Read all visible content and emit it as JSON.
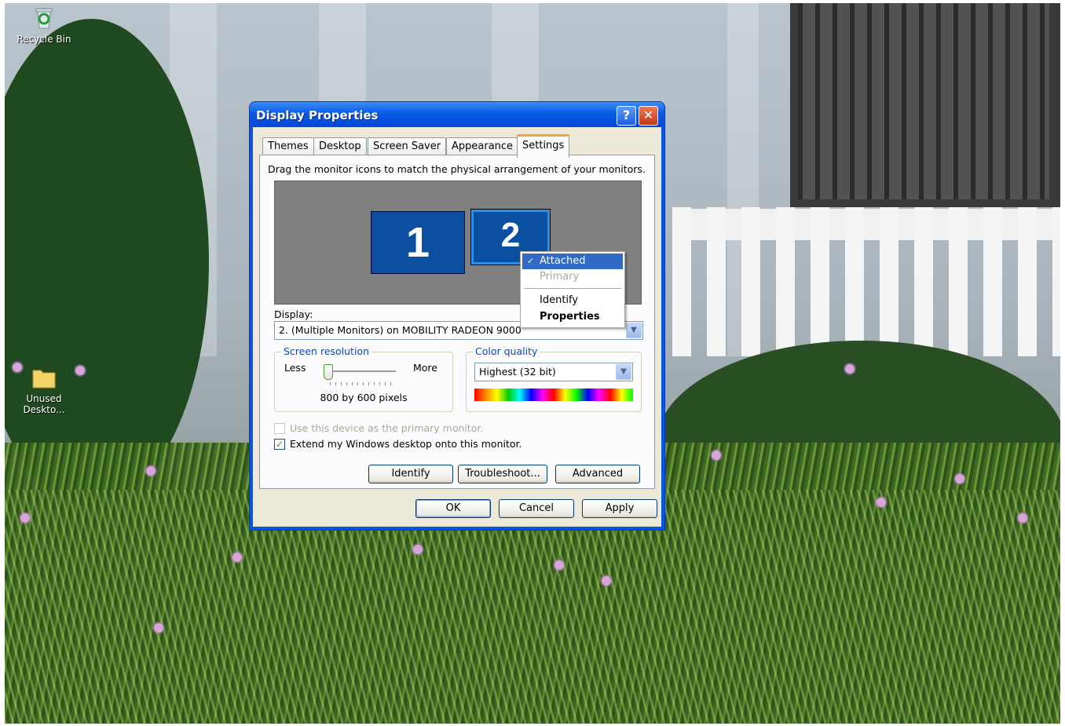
{
  "desktop": {
    "icons": [
      {
        "label": "Recycle Bin"
      },
      {
        "label": "Unused Deskto..."
      }
    ]
  },
  "dialog": {
    "title": "Display Properties",
    "help_glyph": "?",
    "close_glyph": "✕",
    "tabs": [
      {
        "label": "Themes"
      },
      {
        "label": "Desktop"
      },
      {
        "label": "Screen Saver"
      },
      {
        "label": "Appearance"
      },
      {
        "label": "Settings",
        "active": true
      }
    ],
    "settings": {
      "instruction": "Drag the monitor icons to match the physical arrangement of your monitors.",
      "monitors": [
        {
          "number": "1"
        },
        {
          "number": "2"
        }
      ],
      "display_label": "Display:",
      "display_value": "2. (Multiple Monitors) on MOBILITY RADEON 9000",
      "screen_resolution": {
        "title": "Screen resolution",
        "less": "Less",
        "more": "More",
        "value": "800 by 600 pixels"
      },
      "color_quality": {
        "title": "Color quality",
        "value": "Highest (32 bit)"
      },
      "use_primary_label": "Use this device as the primary monitor.",
      "extend_label": "Extend my Windows desktop onto this monitor.",
      "extend_checked_glyph": "✓",
      "buttons": {
        "identify": "Identify",
        "troubleshoot": "Troubleshoot...",
        "advanced": "Advanced"
      }
    },
    "footer_buttons": {
      "ok": "OK",
      "cancel": "Cancel",
      "apply": "Apply"
    }
  },
  "context_menu": {
    "check_glyph": "✓",
    "items": [
      {
        "label": "Attached",
        "checked": true,
        "highlighted": true
      },
      {
        "label": "Primary",
        "disabled": true
      },
      {
        "label": "Identify"
      },
      {
        "label": "Properties",
        "bold": true
      }
    ]
  }
}
